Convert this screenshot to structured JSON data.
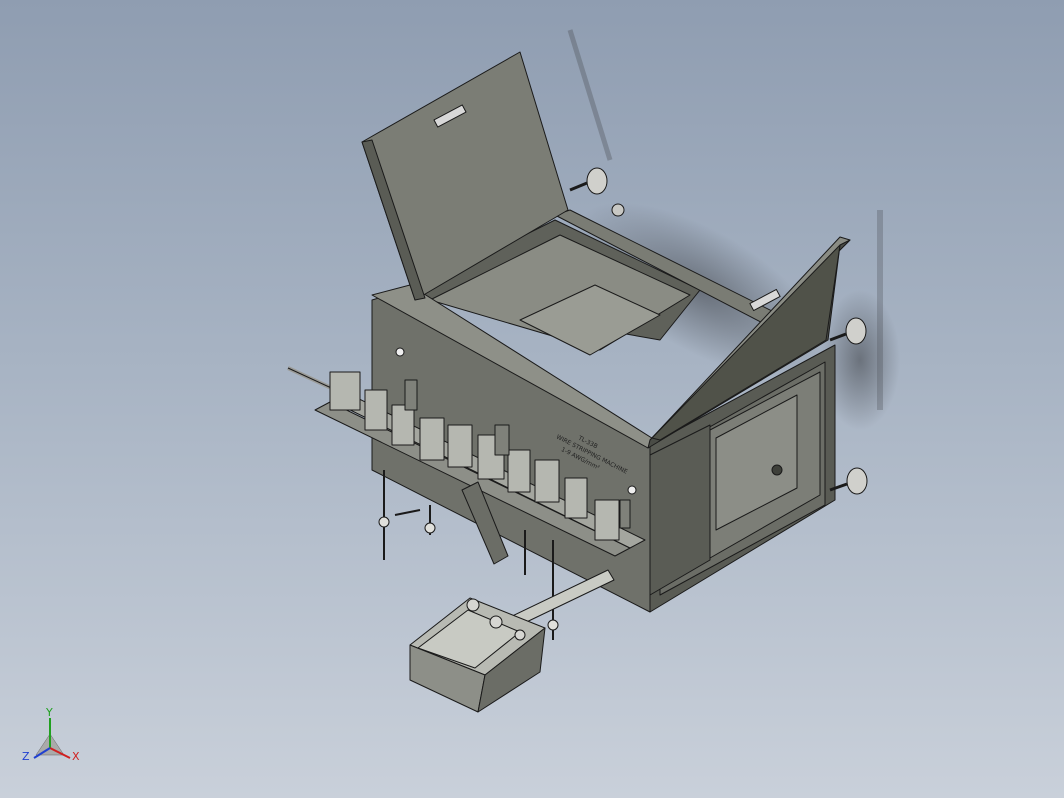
{
  "nameplate": {
    "line1": "TL-33B",
    "line2": "WIRE STRIPPING MACHINE",
    "line3": "1-9 AWG/mm²"
  },
  "triad": {
    "axis_x": "X",
    "axis_y": "Y",
    "axis_z": "Z"
  },
  "colors": {
    "background_top": "#8f9db1",
    "background_bottom": "#c9d0da",
    "body_gray": "#6f716a",
    "body_dark": "#55574f",
    "lid_gray": "#7b7d75",
    "edge": "#1a1a1a",
    "axis_x": "#d02020",
    "axis_y": "#20a020",
    "axis_z": "#2040d0"
  }
}
